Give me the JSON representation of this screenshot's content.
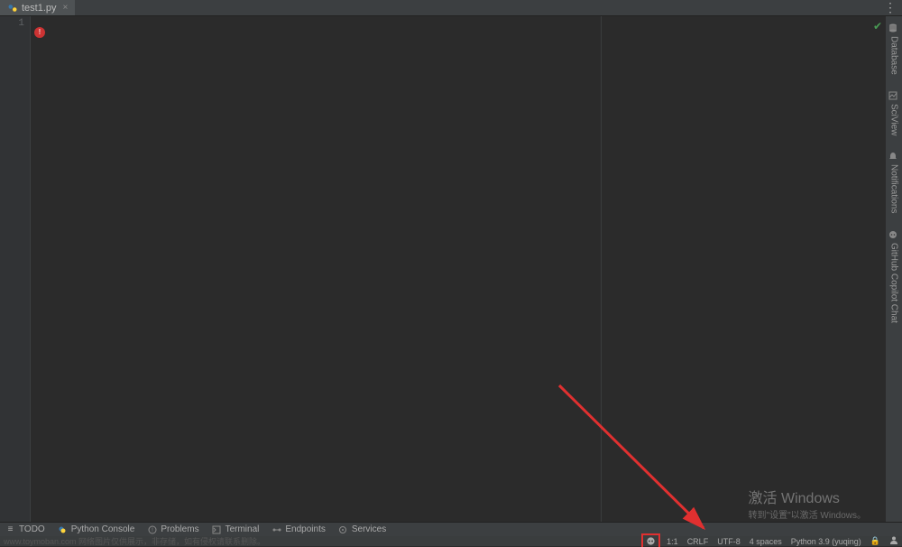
{
  "tab": {
    "filename": "test1.py"
  },
  "gutter": {
    "line1": "1"
  },
  "right_rail": {
    "items": [
      {
        "label": "Database"
      },
      {
        "label": "SciView"
      },
      {
        "label": "Notifications"
      },
      {
        "label": "GitHub Copilot Chat"
      }
    ]
  },
  "bottom_tools": {
    "todo": "TODO",
    "python_console": "Python Console",
    "problems": "Problems",
    "terminal": "Terminal",
    "endpoints": "Endpoints",
    "services": "Services"
  },
  "status": {
    "watermark": "www.toymoban.com 网络图片仅供展示，非存储，如有侵权请联系删除。",
    "position": "1:1",
    "line_sep": "CRLF",
    "encoding": "UTF-8",
    "indent": "4 spaces",
    "interpreter": "Python 3.9 (yuqing)"
  },
  "activate": {
    "title": "激活 Windows",
    "sub": "转到\"设置\"以激活 Windows。"
  }
}
